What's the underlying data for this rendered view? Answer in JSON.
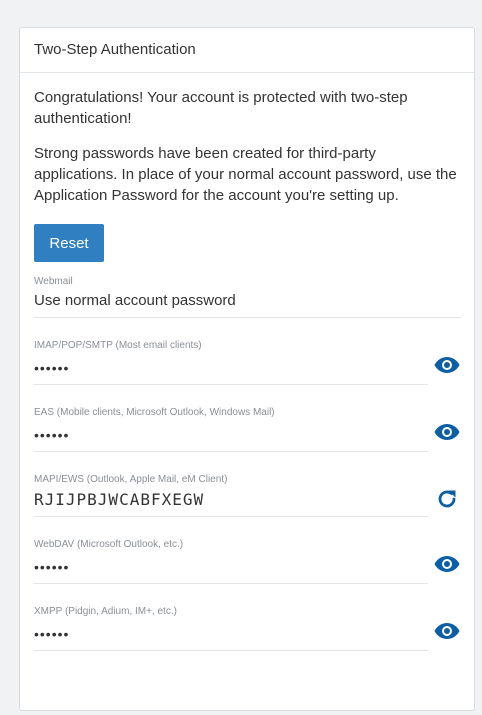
{
  "panel": {
    "title": "Two-Step Authentication",
    "message1": "Congratulations! Your account is protected with two-step authentication!",
    "message2": "Strong passwords have been created for third-party applications. In place of your normal account password, use the Application Password for the account you're setting up.",
    "reset_label": "Reset"
  },
  "fields": [
    {
      "label": "Webmail",
      "value": "Use normal account password"
    },
    {
      "label": "IMAP/POP/SMTP (Most email clients)",
      "value": "••••••",
      "icon": "eye-icon"
    },
    {
      "label": "EAS (Mobile clients, Microsoft Outlook, Windows Mail)",
      "value": "••••••",
      "icon": "eye-icon"
    },
    {
      "label": "MAPI/EWS (Outlook, Apple Mail, eM Client)",
      "value": "RJIJPBJWCABFXEGW",
      "icon": "refresh-icon"
    },
    {
      "label": "WebDAV (Microsoft Outlook, etc.)",
      "value": "••••••",
      "icon": "eye-icon"
    },
    {
      "label": "XMPP (Pidgin, Adium, IM+, etc.)",
      "value": "••••••",
      "icon": "eye-icon"
    }
  ],
  "colors": {
    "accent": "#2f7fc1",
    "icon": "#0e5ea3"
  }
}
